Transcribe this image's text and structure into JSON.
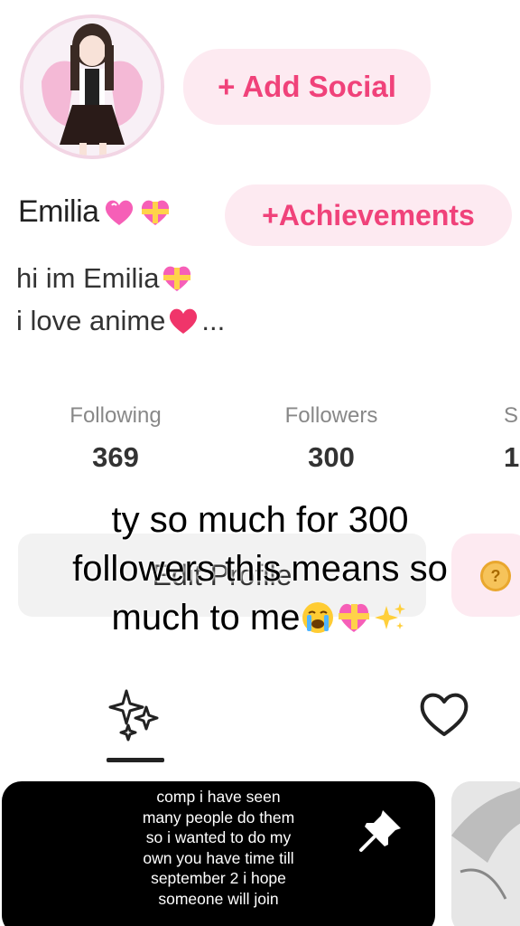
{
  "profile": {
    "name": "Emilia",
    "bio_line1": "hi im Emilia",
    "bio_line2": "i love anime",
    "bio_more": "..."
  },
  "buttons": {
    "add_social": "+ Add Social",
    "achievements": "+Achievements",
    "edit_profile": "Edit Profile"
  },
  "stats": [
    {
      "label": "Following",
      "value": "369"
    },
    {
      "label": "Followers",
      "value": "300"
    },
    {
      "label": "S",
      "value": "1"
    }
  ],
  "caption": {
    "line1": "ty so much for 300",
    "line2": "followers this means so",
    "line3": "much to me"
  },
  "posts": [
    {
      "text_lines": [
        "comp i have seen",
        "many people do them",
        "so i wanted to do my",
        "own you have time till",
        "september 2  i hope",
        "someone will join"
      ]
    }
  ],
  "icons": {
    "posts_tab": "sparkles-icon",
    "likes_tab": "heart-outline-icon",
    "pin": "pin-icon"
  },
  "colors": {
    "accent": "#f0427a",
    "pill_bg": "#fdeaf1"
  }
}
